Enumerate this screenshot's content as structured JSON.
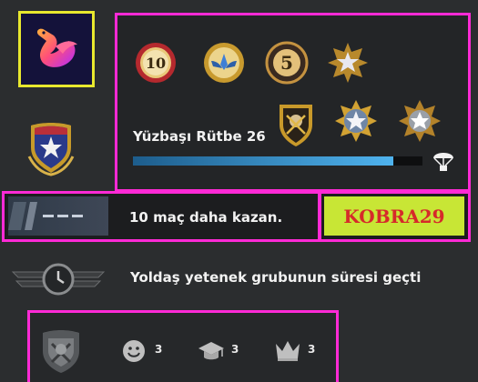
{
  "profile": {
    "avatar_icon": "swan-logo-icon",
    "rank_name": "Yüzbaşı Rütbe 26",
    "xp_progress": 0.9,
    "medals_top": [
      "10-year-coin-icon",
      "wings-coin-icon",
      "5-year-coin-icon",
      "service-star-medal-icon"
    ],
    "medals_bottom": [
      "skull-crest-medal-icon",
      "star-gear-medal-icon",
      "silver-star-medal-icon"
    ],
    "drop_icon": "parachute-drop-icon"
  },
  "win_panel": {
    "icon": "rank-pending-icon",
    "text": "10 maç daha kazan.",
    "code": "KOBRA29"
  },
  "cooldown": {
    "icon": "clock-wings-icon",
    "text": "Yoldaş yetenek grubunun süresi geçti"
  },
  "commends": {
    "items": [
      {
        "icon": "smiley-icon",
        "count": "3"
      },
      {
        "icon": "graduation-cap-icon",
        "count": "3"
      },
      {
        "icon": "crown-icon",
        "count": "3"
      }
    ]
  },
  "colors": {
    "highlight": "#ff2ad6",
    "code_bg": "#c8e635",
    "code_text": "#d62a2a",
    "avatar_border": "#e8e82e",
    "xp_fill": "#4fb3ee"
  }
}
